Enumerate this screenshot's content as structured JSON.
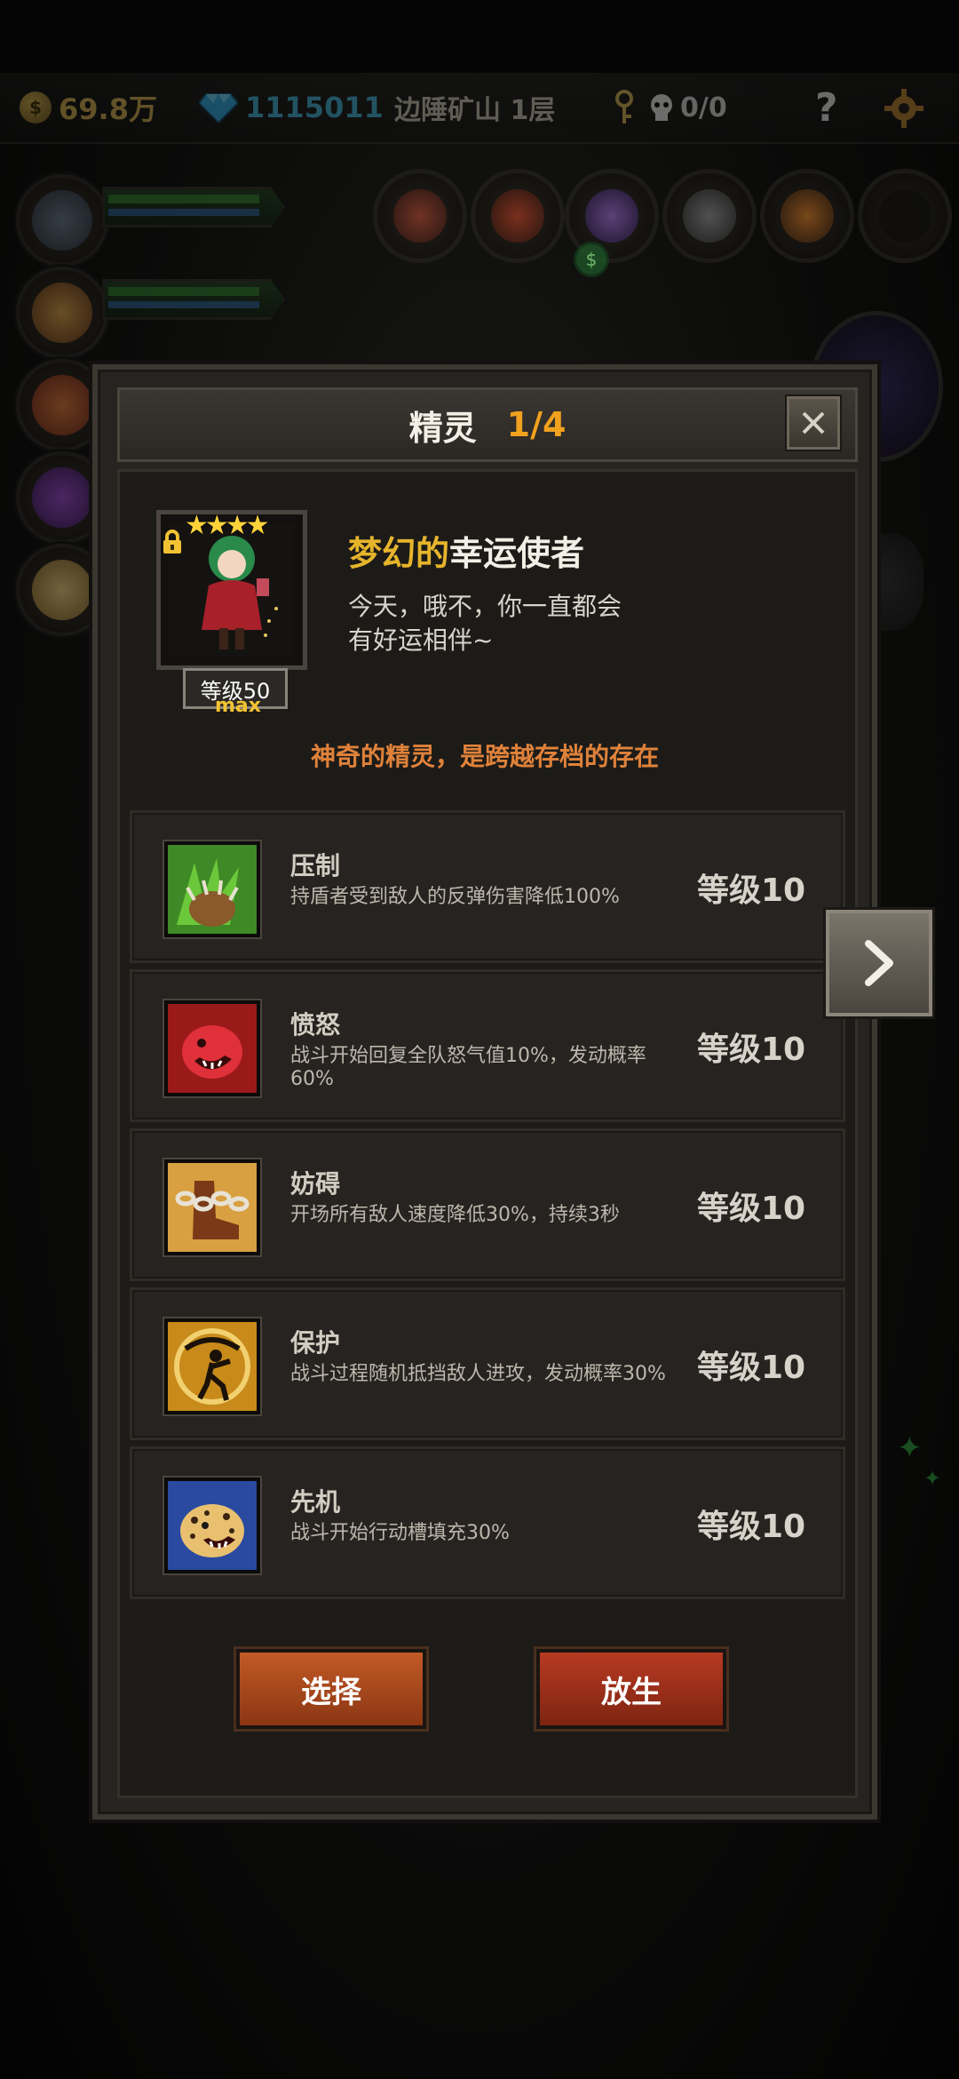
{
  "resources": {
    "gold": "69.8万",
    "gems": "1115011",
    "location": "边陲矿山 1层",
    "keys": "0/0",
    "help_icon": "?",
    "gold_icon": "coin-icon",
    "gem_icon": "diamond-icon"
  },
  "dialog": {
    "title": "精灵",
    "page": "1/4",
    "close_icon": "close-icon"
  },
  "spirit": {
    "name_prefix": "梦幻的",
    "name_main": "幸运使者",
    "stars": "★★★★",
    "level_label": "等级50",
    "max_label": "max",
    "description_line1": "今天，哦不，你一直都会",
    "description_line2": "有好运相伴~",
    "tagline": "神奇的精灵，是跨越存档的存在"
  },
  "skills": [
    {
      "name": "压制",
      "desc": "持盾者受到敌人的反弹伤害降低100%",
      "level": "等级10",
      "icon": "claw-icon"
    },
    {
      "name": "愤怒",
      "desc": "战斗开始回复全队怒气值10%，发动概率60%",
      "level": "等级10",
      "icon": "roaring-beast-icon"
    },
    {
      "name": "妨碍",
      "desc": "开场所有敌人速度降低30%，持续3秒",
      "level": "等级10",
      "icon": "chained-boot-icon"
    },
    {
      "name": "保护",
      "desc": "战斗过程随机抵挡敌人进攻，发动概率30%",
      "level": "等级10",
      "icon": "shield-figure-icon"
    },
    {
      "name": "先机",
      "desc": "战斗开始行动槽填充30%",
      "level": "等级10",
      "icon": "leopard-icon"
    }
  ],
  "buttons": {
    "select": "选择",
    "release": "放生"
  },
  "colors": {
    "accent_gold": "#e6b52c",
    "name_white": "#f3efe6",
    "tagline_orange": "#e0823a",
    "page_orange": "#f0a11e"
  }
}
